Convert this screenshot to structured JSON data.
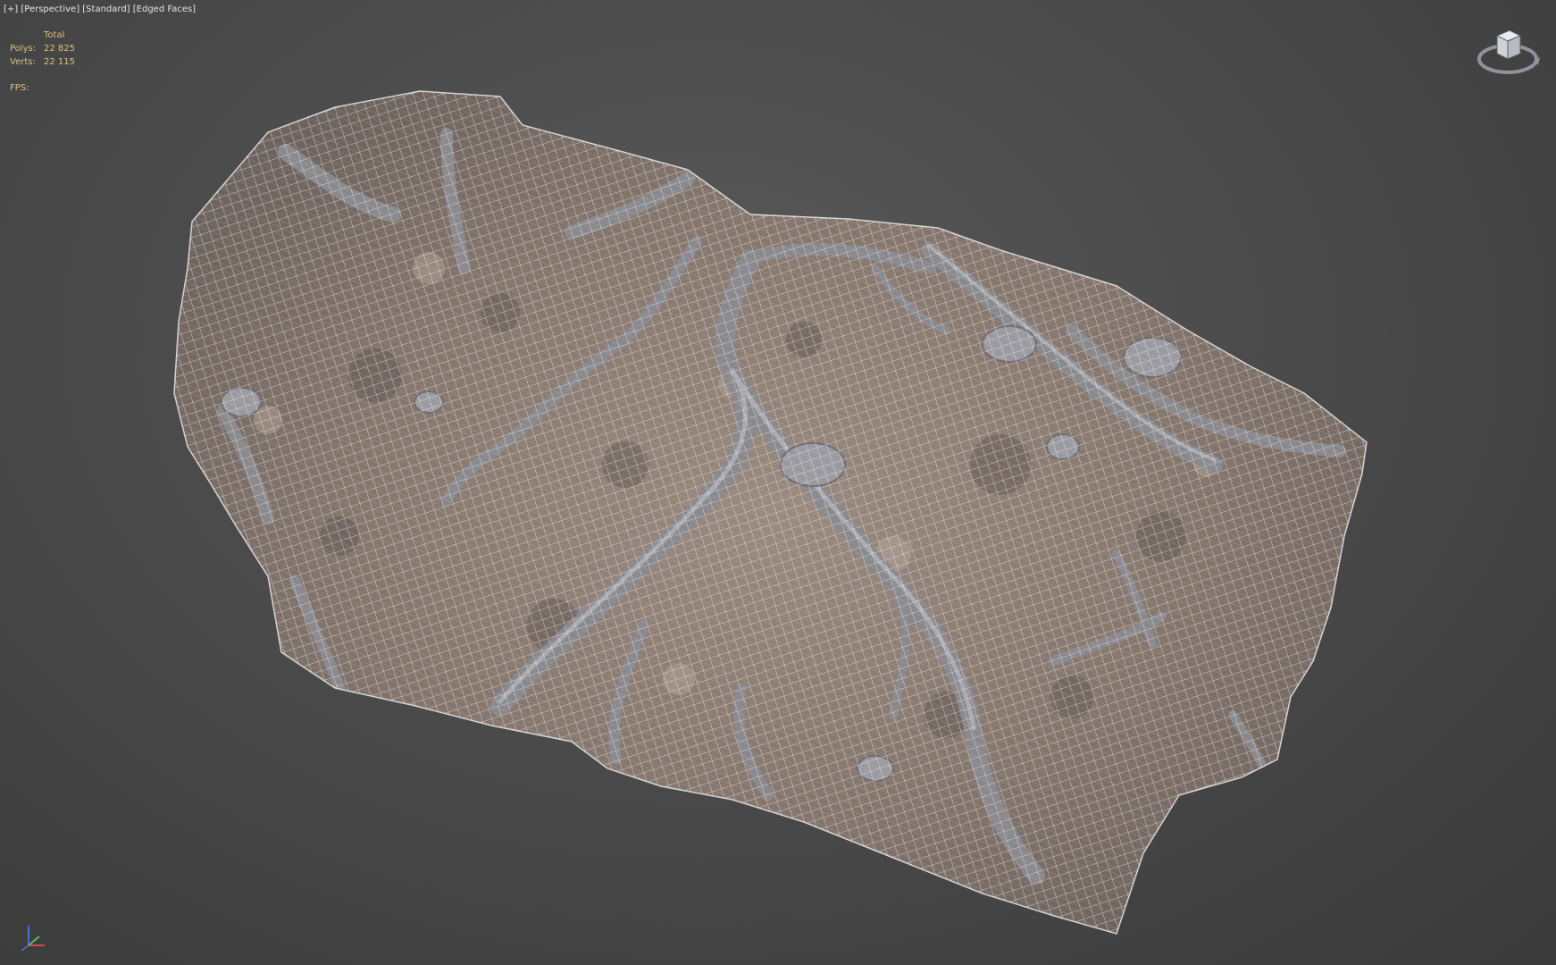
{
  "viewport": {
    "label_parts": [
      "[+]",
      "[Perspective]",
      "[Standard]",
      "[Edged Faces]"
    ]
  },
  "stats": {
    "header": "Total",
    "polys_label": "Polys:",
    "polys_value": "22 825",
    "verts_label": "Verts:",
    "verts_value": "22 115",
    "fps_label": "FPS:"
  },
  "icons": {
    "viewcube": "viewcube-icon",
    "axis": "axis-tripod-icon"
  },
  "colors": {
    "background": "#4b4b4b",
    "hud_text": "#d8c27a",
    "label_text": "#e4e4e4",
    "mesh_fill": "#8c7d74",
    "wire": "#f2f2f2",
    "root": "#7f7f84"
  }
}
